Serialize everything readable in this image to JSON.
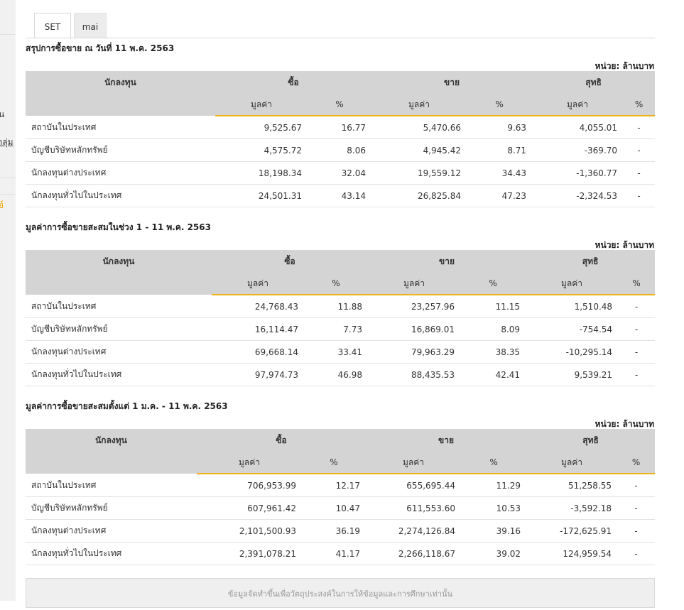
{
  "sidebar_fragments": [
    "น",
    "กลุ่ม",
    "ย์"
  ],
  "tabs": [
    {
      "label": "SET",
      "active": true
    },
    {
      "label": "mai",
      "active": false
    }
  ],
  "tables": [
    {
      "title": "สรุปการซื้อขาย ณ วันที่ 11 พ.ค. 2563",
      "unit": "หน่วย: ล้านบาท",
      "head": {
        "investor": "นักลงทุน",
        "buy": "ซื้อ",
        "sell": "ขาย",
        "net": "สุทธิ",
        "value": "มูลค่า",
        "pct": "%"
      },
      "rows": [
        {
          "name": "สถาบันในประเทศ",
          "buy_val": "9,525.67",
          "buy_pct": "16.77",
          "sell_val": "5,470.66",
          "sell_pct": "9.63",
          "net_val": "4,055.01",
          "net_sign": "pos",
          "net_pct": "-"
        },
        {
          "name": "บัญชีบริษัทหลักทรัพย์",
          "buy_val": "4,575.72",
          "buy_pct": "8.06",
          "sell_val": "4,945.42",
          "sell_pct": "8.71",
          "net_val": "-369.70",
          "net_sign": "neg",
          "net_pct": "-"
        },
        {
          "name": "นักลงทุนต่างประเทศ",
          "buy_val": "18,198.34",
          "buy_pct": "32.04",
          "sell_val": "19,559.12",
          "sell_pct": "34.43",
          "net_val": "-1,360.77",
          "net_sign": "neg",
          "net_pct": "-"
        },
        {
          "name": "นักลงทุนทั่วไปในประเทศ",
          "buy_val": "24,501.31",
          "buy_pct": "43.14",
          "sell_val": "26,825.84",
          "sell_pct": "47.23",
          "net_val": "-2,324.53",
          "net_sign": "neg",
          "net_pct": "-"
        }
      ]
    },
    {
      "title": "มูลค่าการซื้อขายสะสมในช่วง 1 - 11 พ.ค. 2563",
      "unit": "หน่วย: ล้านบาท",
      "head": {
        "investor": "นักลงทุน",
        "buy": "ซื้อ",
        "sell": "ขาย",
        "net": "สุทธิ",
        "value": "มูลค่า",
        "pct": "%"
      },
      "rows": [
        {
          "name": "สถาบันในประเทศ",
          "buy_val": "24,768.43",
          "buy_pct": "11.88",
          "sell_val": "23,257.96",
          "sell_pct": "11.15",
          "net_val": "1,510.48",
          "net_sign": "pos",
          "net_pct": "-"
        },
        {
          "name": "บัญชีบริษัทหลักทรัพย์",
          "buy_val": "16,114.47",
          "buy_pct": "7.73",
          "sell_val": "16,869.01",
          "sell_pct": "8.09",
          "net_val": "-754.54",
          "net_sign": "neg",
          "net_pct": "-"
        },
        {
          "name": "นักลงทุนต่างประเทศ",
          "buy_val": "69,668.14",
          "buy_pct": "33.41",
          "sell_val": "79,963.29",
          "sell_pct": "38.35",
          "net_val": "-10,295.14",
          "net_sign": "neg",
          "net_pct": "-"
        },
        {
          "name": "นักลงทุนทั่วไปในประเทศ",
          "buy_val": "97,974.73",
          "buy_pct": "46.98",
          "sell_val": "88,435.53",
          "sell_pct": "42.41",
          "net_val": "9,539.21",
          "net_sign": "pos",
          "net_pct": "-"
        }
      ]
    },
    {
      "title": "มูลค่าการซื้อขายสะสมตั้งแต่ 1 ม.ค. - 11 พ.ค. 2563",
      "unit": "หน่วย: ล้านบาท",
      "head": {
        "investor": "นักลงทุน",
        "buy": "ซื้อ",
        "sell": "ขาย",
        "net": "สุทธิ",
        "value": "มูลค่า",
        "pct": "%"
      },
      "rows": [
        {
          "name": "สถาบันในประเทศ",
          "buy_val": "706,953.99",
          "buy_pct": "12.17",
          "sell_val": "655,695.44",
          "sell_pct": "11.29",
          "net_val": "51,258.55",
          "net_sign": "pos",
          "net_pct": "-"
        },
        {
          "name": "บัญชีบริษัทหลักทรัพย์",
          "buy_val": "607,961.42",
          "buy_pct": "10.47",
          "sell_val": "611,553.60",
          "sell_pct": "10.53",
          "net_val": "-3,592.18",
          "net_sign": "neg",
          "net_pct": "-"
        },
        {
          "name": "นักลงทุนต่างประเทศ",
          "buy_val": "2,101,500.93",
          "buy_pct": "36.19",
          "sell_val": "2,274,126.84",
          "sell_pct": "39.16",
          "net_val": "-172,625.91",
          "net_sign": "neg",
          "net_pct": "-"
        },
        {
          "name": "นักลงทุนทั่วไปในประเทศ",
          "buy_val": "2,391,078.21",
          "buy_pct": "41.17",
          "sell_val": "2,266,118.67",
          "sell_pct": "39.02",
          "net_val": "124,959.54",
          "net_sign": "pos",
          "net_pct": "-"
        }
      ]
    }
  ],
  "footer": {
    "note": "ข้อมูลจัดทำขึ้นเพื่อวัตถุประสงค์ในการให้ข้อมูลและการศึกษาเท่านั้น"
  },
  "colors": {
    "positive": "#2b8a1e",
    "negative": "#e0001b",
    "header_bg": "#d4d4d4",
    "accent_underline": "#f0b31c"
  }
}
